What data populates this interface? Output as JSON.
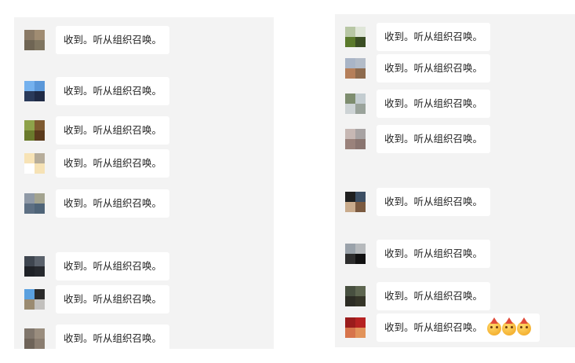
{
  "message_text": "收到。听从组织召唤。",
  "left_messages": [
    {
      "avatar": [
        "#8a7a66",
        "#a08c72",
        "#6f6554",
        "#7f7560"
      ]
    },
    {
      "avatar": [
        "#74b1ee",
        "#5a97d9",
        "#2a3a5a",
        "#1f2a45"
      ]
    },
    {
      "avatar": [
        "#8ea24a",
        "#7e5a30",
        "#6a7a2c",
        "#5a3a1c"
      ]
    },
    {
      "avatar": [
        "#f7e3b6",
        "#b7ad9a",
        "#ffffff",
        "#f6e2b5"
      ]
    },
    {
      "avatar": [
        "#8f99a6",
        "#a3a38f",
        "#5d6f83",
        "#4f6478"
      ]
    },
    {
      "avatar": [
        "#3f4650",
        "#5a616b",
        "#1f2227",
        "#26292e"
      ]
    },
    {
      "avatar": [
        "#5aa0df",
        "#2a2a2a",
        "#9b8b71",
        "#c2c0bd"
      ]
    },
    {
      "avatar": [
        "#80766c",
        "#9a8d7e",
        "#6e6358",
        "#8a7d70"
      ]
    }
  ],
  "right_messages": [
    {
      "avatar": [
        "#b8c7a5",
        "#dfe6d8",
        "#5b7a2c",
        "#3b4e24"
      ]
    },
    {
      "avatar": [
        "#a9b5c7",
        "#b3bcc8",
        "#b57f5a",
        "#8e6b4e"
      ]
    },
    {
      "avatar": [
        "#7e8d6f",
        "#c3ccd0",
        "#cdd3d5",
        "#9aa39b"
      ]
    },
    {
      "avatar": [
        "#c7b8b4",
        "#a8a3a3",
        "#9a827b",
        "#8a7570"
      ]
    },
    {
      "avatar": [
        "#1f1f1f",
        "#3c4e63",
        "#c9ab8c",
        "#7b5a40"
      ]
    },
    {
      "avatar": [
        "#9aa2aa",
        "#b6b9bc",
        "#2d2d2d",
        "#111111"
      ]
    },
    {
      "avatar": [
        "#485040",
        "#5e6650",
        "#2c2c24",
        "#353528"
      ]
    },
    {
      "avatar": [
        "#9a1c1c",
        "#b62222",
        "#d7744b",
        "#e2935a"
      ],
      "emoji": [
        "party-face-emoji",
        "party-face-emoji",
        "party-face-emoji"
      ]
    }
  ],
  "colors": {
    "panel_bg": "#f3f3f3",
    "bubble_bg": "#ffffff",
    "text": "#222222"
  }
}
